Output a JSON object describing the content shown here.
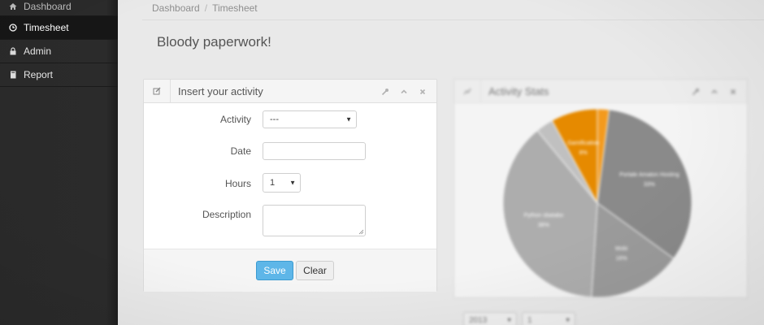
{
  "sidebar": {
    "items": [
      {
        "label": "Dashboard",
        "icon": "home-icon"
      },
      {
        "label": "Timesheet",
        "icon": "clock-icon",
        "active": true
      },
      {
        "label": "Admin",
        "icon": "lock-icon"
      },
      {
        "label": "Report",
        "icon": "book-icon"
      }
    ]
  },
  "breadcrumb": {
    "items": [
      "Dashboard",
      "Timesheet"
    ],
    "separator": "/"
  },
  "page_title": "Bloody paperwork!",
  "activity_panel": {
    "title": "Insert your activity",
    "icon": "edit-icon",
    "tools": [
      "wrench-icon",
      "chevron-up-icon",
      "close-icon"
    ],
    "fields": {
      "activity": {
        "label": "Activity",
        "value": "---"
      },
      "date": {
        "label": "Date",
        "value": ""
      },
      "hours": {
        "label": "Hours",
        "value": "1"
      },
      "description": {
        "label": "Description",
        "value": ""
      }
    },
    "buttons": {
      "save": "Save",
      "clear": "Clear"
    },
    "colors": {
      "save_bg": "#5eb6e8"
    }
  },
  "stats_panel": {
    "title": "Activity Stats",
    "icon": "chart-icon",
    "tools": [
      "wrench-icon",
      "chevron-up-icon",
      "close-icon"
    ],
    "year_select": "2013",
    "month_select": "1"
  },
  "chart_data": {
    "type": "pie",
    "slices": [
      {
        "label": "Gamification",
        "value": 8,
        "pct_label": "8%",
        "color": "#e68a00"
      },
      {
        "label": "",
        "value": 2,
        "pct_label": "",
        "color": "#f39a1d"
      },
      {
        "label": "Portale Amaton Hosting",
        "value": 33,
        "pct_label": "33%",
        "color": "#8a8a8a"
      },
      {
        "label": "Mobi",
        "value": 16,
        "pct_label": "16%",
        "color": "#9b9b9b"
      },
      {
        "label": "Python sbatabo",
        "value": 38,
        "pct_label": "38%",
        "color": "#adadad"
      },
      {
        "label": "",
        "value": 3,
        "pct_label": "",
        "color": "#c0c0c0"
      }
    ]
  }
}
